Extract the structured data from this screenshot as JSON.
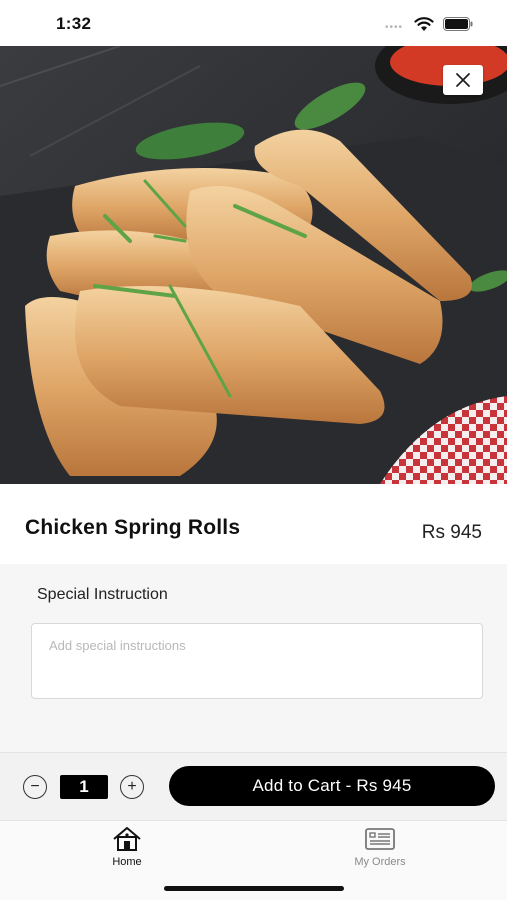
{
  "status_bar": {
    "time": "1:32",
    "signal_dots": "••••",
    "wifi_icon": "wifi-icon",
    "battery_icon": "battery-icon"
  },
  "hero": {
    "image": "chicken-spring-rolls-photo",
    "close_icon": "close-icon"
  },
  "product": {
    "title": "Chicken Spring Rolls",
    "price": "Rs 945"
  },
  "instructions": {
    "label": "Special Instruction",
    "value": "",
    "placeholder": "Add special instructions"
  },
  "cart": {
    "minus_symbol": "−",
    "quantity": "1",
    "plus_symbol": "+",
    "add_button_label": "Add to Cart - Rs 945"
  },
  "tabs": [
    {
      "label": "Home",
      "icon": "home-icon",
      "active": true
    },
    {
      "label": "My Orders",
      "icon": "orders-icon",
      "active": false
    }
  ],
  "colors": {
    "primary": "#000000",
    "panel_bg": "#f6f6f6",
    "tab_inactive": "#8a8a8a"
  }
}
